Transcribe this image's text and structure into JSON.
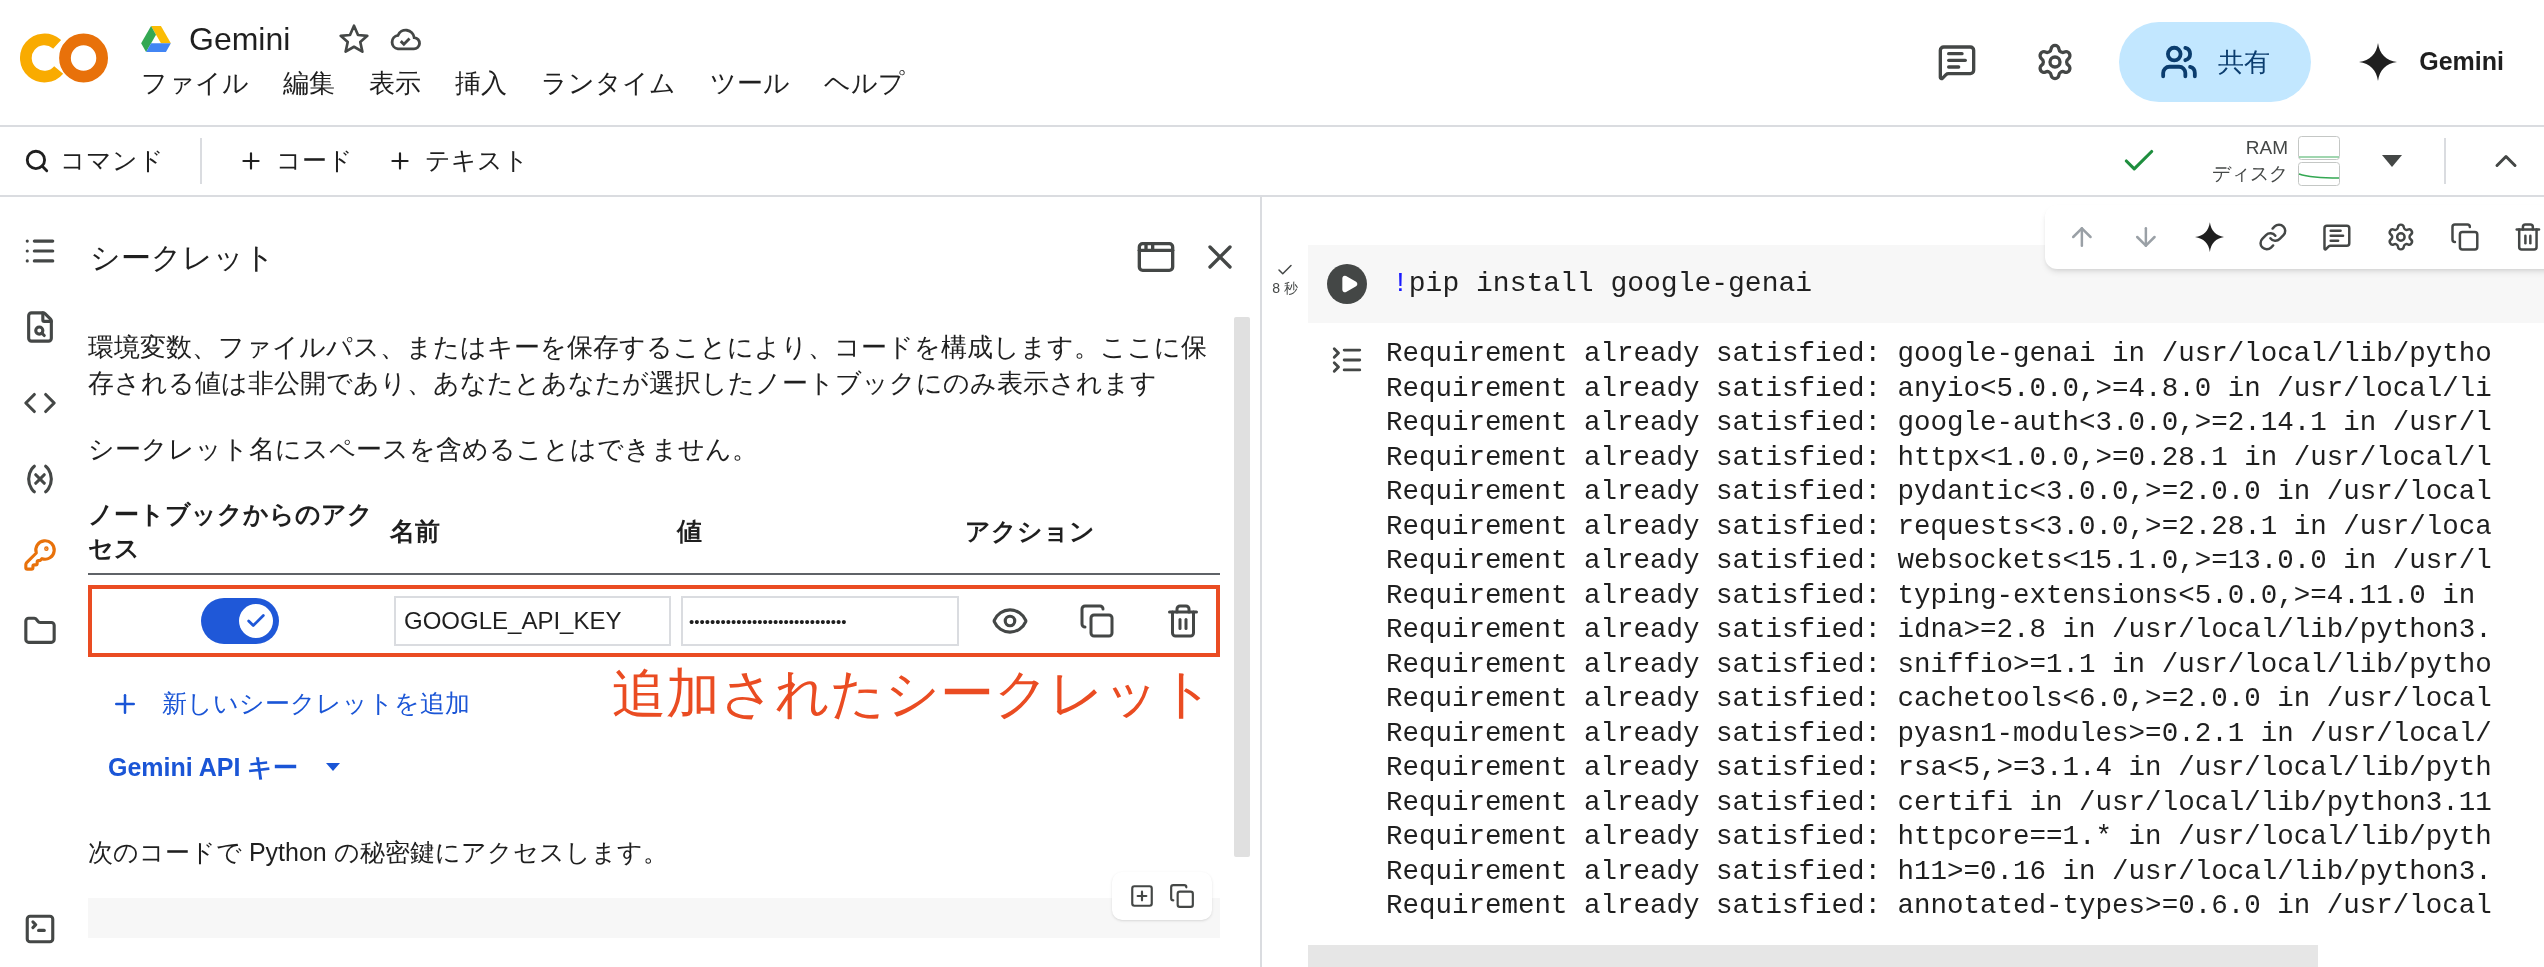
{
  "header": {
    "title": "Gemini",
    "menu": [
      "ファイル",
      "編集",
      "表示",
      "挿入",
      "ランタイム",
      "ツール",
      "ヘルプ"
    ],
    "share_label": "共有",
    "gemini_label": "Gemini"
  },
  "toolbar": {
    "command": "コマンド",
    "add_code": "コード",
    "add_text": "テキスト",
    "ram_label": "RAM",
    "disk_label": "ディスク"
  },
  "sidebar": {
    "items": [
      {
        "kind": "toc",
        "selected": false
      },
      {
        "kind": "find",
        "selected": false
      },
      {
        "kind": "snippets",
        "selected": false
      },
      {
        "kind": "variables",
        "selected": false
      },
      {
        "kind": "secrets",
        "selected": true
      },
      {
        "kind": "files",
        "selected": false
      },
      {
        "kind": "terminal",
        "selected": false
      }
    ]
  },
  "secrets_panel": {
    "title": "シークレット",
    "description": "環境変数、ファイルパス、またはキーを保存することにより、コードを構成します。ここに保存される値は非公開であり、あなたとあなたが選択したノートブックにのみ表示されます",
    "note": "シークレット名にスペースを含めることはできません。",
    "columns": [
      "ノートブックからのアクセス",
      "名前",
      "値",
      "アクション"
    ],
    "secrets": [
      {
        "access": true,
        "name": "GOOGLE_API_KEY",
        "value": "••••••••••••••••••••••••••••••"
      }
    ],
    "annotation": "追加されたシークレット",
    "add_link": "新しいシークレットを追加",
    "api_key_menu": "Gemini API キー",
    "code_intro": "次のコードで Python の秘密鍵にアクセスします。"
  },
  "cell": {
    "status": "8 秒",
    "code_prefix": "!",
    "code": "pip install google-genai",
    "output": [
      "Requirement already satisfied: google-genai in /usr/local/lib/pytho",
      "Requirement already satisfied: anyio<5.0.0,>=4.8.0 in /usr/local/li",
      "Requirement already satisfied: google-auth<3.0.0,>=2.14.1 in /usr/l",
      "Requirement already satisfied: httpx<1.0.0,>=0.28.1 in /usr/local/l",
      "Requirement already satisfied: pydantic<3.0.0,>=2.0.0 in /usr/local",
      "Requirement already satisfied: requests<3.0.0,>=2.28.1 in /usr/loca",
      "Requirement already satisfied: websockets<15.1.0,>=13.0.0 in /usr/l",
      "Requirement already satisfied: typing-extensions<5.0.0,>=4.11.0 in",
      "Requirement already satisfied: idna>=2.8 in /usr/local/lib/python3.",
      "Requirement already satisfied: sniffio>=1.1 in /usr/local/lib/pytho",
      "Requirement already satisfied: cachetools<6.0,>=2.0.0 in /usr/local",
      "Requirement already satisfied: pyasn1-modules>=0.2.1 in /usr/local/",
      "Requirement already satisfied: rsa<5,>=3.1.4 in /usr/local/lib/pyth",
      "Requirement already satisfied: certifi in /usr/local/lib/python3.11",
      "Requirement already satisfied: httpcore==1.* in /usr/local/lib/pyth",
      "Requirement already satisfied: h11>=0.16 in /usr/local/lib/python3.",
      "Requirement already satisfied: annotated-types>=0.6.0 in /usr/local"
    ]
  }
}
